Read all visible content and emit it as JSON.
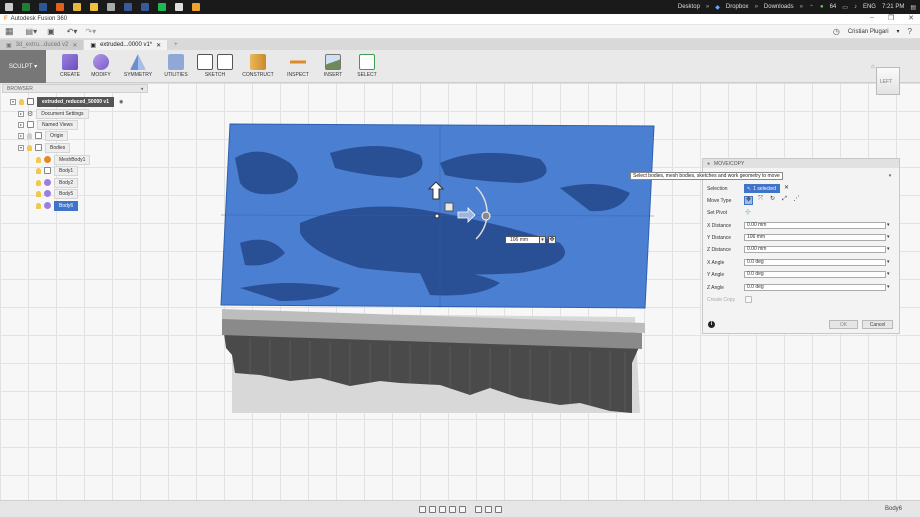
{
  "taskbar": {
    "desktop": "Desktop",
    "dropbox": "Dropbox",
    "downloads": "Downloads",
    "temp": "64",
    "lang": "ENG",
    "time": "7:21 PM"
  },
  "window": {
    "title": "Autodesk Fusion 360"
  },
  "account": {
    "user": "Cristian Plugari"
  },
  "tabs": [
    {
      "label": "3d_extru...duced v2"
    },
    {
      "label": "extruded...0000 v1*"
    }
  ],
  "toolbar": {
    "workspace": "SCULPT",
    "groups": [
      "CREATE",
      "MODIFY",
      "SYMMETRY",
      "UTILITIES",
      "SKETCH",
      "CONSTRUCT",
      "INSPECT",
      "INSERT",
      "SELECT"
    ]
  },
  "browser": {
    "title": "BROWSER",
    "root": "extruded_reduced_50000 v1",
    "items": [
      "Document Settings",
      "Named Views",
      "Origin",
      "Bodies"
    ],
    "bodies": [
      "MeshBody1",
      "Body1",
      "Body2",
      "Body5",
      "Body6"
    ]
  },
  "viewcube": {
    "face": "LEFT"
  },
  "tooltip": "Select bodies, mesh bodies, sketches and work geometry to move",
  "distance_box": {
    "value": "106 mm"
  },
  "dialog": {
    "title": "MOVE/COPY",
    "selection_label": "Selection",
    "selection_value": "1 selected",
    "move_type_label": "Move Type",
    "set_pivot_label": "Set Pivot",
    "x_distance_label": "X Distance",
    "x_distance": "0.00 mm",
    "y_distance_label": "Y Distance",
    "y_distance": "106 mm",
    "z_distance_label": "Z Distance",
    "z_distance": "0.00 mm",
    "x_angle_label": "X Angle",
    "x_angle": "0.0 deg",
    "y_angle_label": "Y Angle",
    "y_angle": "0.0 deg",
    "z_angle_label": "Z Angle",
    "z_angle": "0.0 deg",
    "create_copy_label": "Create Copy",
    "ok": "OK",
    "cancel": "Cancel"
  },
  "status": {
    "selected": "Body6"
  },
  "colors": {
    "accent": "#3f74c9",
    "mesh_blue": "#4a7fd1"
  }
}
